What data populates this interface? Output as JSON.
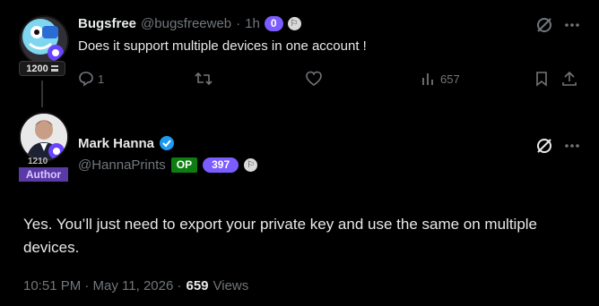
{
  "reply": {
    "author_name": "Bugsfree",
    "handle": "@bugsfreeweb",
    "separator": "·",
    "time": "1h",
    "points_badge": "0",
    "score": "1200",
    "text": "Does it support multiple devices in one account !",
    "reply_count": "1",
    "views": "657"
  },
  "main": {
    "author_name": "Mark Hanna",
    "handle": "@HannaPrints",
    "op_badge": "OP",
    "points_badge": "397",
    "score": "1210",
    "author_tag": "Author",
    "text": "Yes. You’ll just need to export your private key and use the same on multiple devices.",
    "timestamp": "10:51 PM · May 11, 2026 ·",
    "view_count": "659",
    "views_label": "Views"
  },
  "colors": {
    "verified": "#1d9bf0",
    "purple_badge": "#7b5cff",
    "op_green": "#0d7d12",
    "author_purple": "#5a3aa6"
  },
  "icons": [
    "grok-icon",
    "more-icon",
    "reply-icon",
    "retweet-icon",
    "like-icon",
    "views-icon",
    "bookmark-icon",
    "share-icon",
    "verified-icon",
    "flag-icon"
  ]
}
